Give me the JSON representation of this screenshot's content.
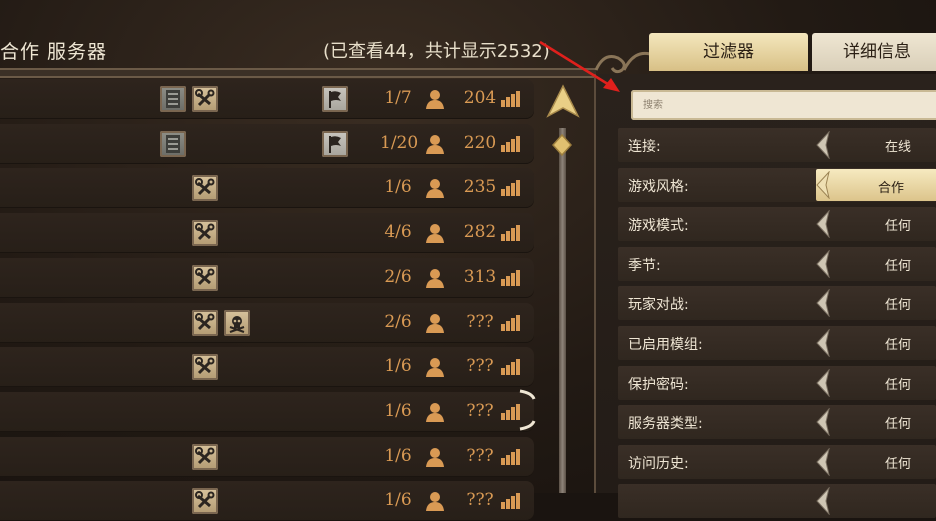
{
  "header": {
    "title": "合作 服务器",
    "count": "(已查看44，共计显示2532)"
  },
  "tabs": [
    {
      "label": "过滤器",
      "active": true
    },
    {
      "label": "详细信息",
      "active": false
    }
  ],
  "search": {
    "placeholder": "搜索",
    "value": ""
  },
  "servers": [
    {
      "tags": [
        "server",
        "wrench"
      ],
      "flag": true,
      "players": "1/7",
      "ping": "204"
    },
    {
      "tags": [
        "server"
      ],
      "flag": true,
      "players": "1/20",
      "ping": "220"
    },
    {
      "tags": [
        "wrench"
      ],
      "flag": false,
      "players": "1/6",
      "ping": "235"
    },
    {
      "tags": [
        "wrench"
      ],
      "flag": false,
      "players": "4/6",
      "ping": "282"
    },
    {
      "tags": [
        "wrench"
      ],
      "flag": false,
      "players": "2/6",
      "ping": "313"
    },
    {
      "tags": [
        "wrench",
        "skull"
      ],
      "flag": false,
      "players": "2/6",
      "ping": "???"
    },
    {
      "tags": [
        "wrench"
      ],
      "flag": false,
      "players": "1/6",
      "ping": "???"
    },
    {
      "tags": [],
      "flag": false,
      "players": "1/6",
      "ping": "???"
    },
    {
      "tags": [
        "wrench"
      ],
      "flag": false,
      "players": "1/6",
      "ping": "???"
    },
    {
      "tags": [
        "wrench"
      ],
      "flag": false,
      "players": "1/6",
      "ping": "???"
    }
  ],
  "filters": [
    {
      "label": "连接:",
      "value": "在线",
      "selected": false
    },
    {
      "label": "游戏风格:",
      "value": "合作",
      "selected": true
    },
    {
      "label": "游戏模式:",
      "value": "任何",
      "selected": false
    },
    {
      "label": "季节:",
      "value": "任何",
      "selected": false
    },
    {
      "label": "玩家对战:",
      "value": "任何",
      "selected": false
    },
    {
      "label": "已启用模组:",
      "value": "任何",
      "selected": false
    },
    {
      "label": "保护密码:",
      "value": "任何",
      "selected": false
    },
    {
      "label": "服务器类型:",
      "value": "任何",
      "selected": false
    },
    {
      "label": "访问历史:",
      "value": "任何",
      "selected": false
    },
    {
      "label": "",
      "value": "",
      "selected": false
    }
  ],
  "colors": {
    "accent": "#d99a54",
    "tab_active": "#e9d7a3",
    "annotation_arrow": "#e0201c"
  }
}
